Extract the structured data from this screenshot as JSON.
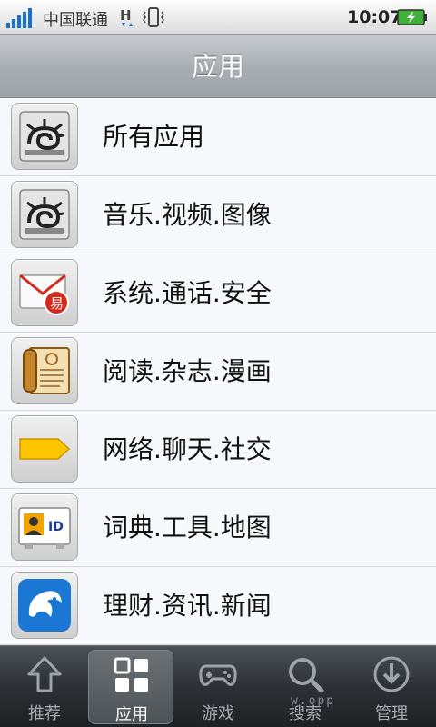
{
  "status_bar": {
    "carrier": "中国联通",
    "network_indicator": "H",
    "time": "10:07",
    "icons": [
      "signal-icon",
      "network-h-icon",
      "vibrate-icon",
      "battery-charging-icon"
    ]
  },
  "header": {
    "title": "应用"
  },
  "categories": [
    {
      "label": "所有应用",
      "icon": "app-store-icon"
    },
    {
      "label": "音乐.视频.图像",
      "icon": "app-store-icon"
    },
    {
      "label": "系统.通话.安全",
      "icon": "mail-envelope-icon"
    },
    {
      "label": "阅读.杂志.漫画",
      "icon": "book-icon"
    },
    {
      "label": "网络.聊天.社交",
      "icon": "yellow-tag-icon"
    },
    {
      "label": "词典.工具.地图",
      "icon": "id-card-icon"
    },
    {
      "label": "理财.资讯.新闻",
      "icon": "dolphin-icon"
    }
  ],
  "tabs": [
    {
      "label": "推荐",
      "icon": "arrow-up-icon",
      "active": false
    },
    {
      "label": "应用",
      "icon": "grid-icon",
      "active": true
    },
    {
      "label": "游戏",
      "icon": "gamepad-icon",
      "active": false
    },
    {
      "label": "搜索",
      "icon": "search-icon",
      "active": false
    },
    {
      "label": "管理",
      "icon": "download-circle-icon",
      "active": false
    }
  ],
  "watermark": "w.opp",
  "colors": {
    "signal": "#1b6fd0",
    "battery": "#3fb13a",
    "tag_yellow": "#ffc400",
    "mail_red": "#d42a1e",
    "dolphin_blue": "#1a78d4"
  }
}
